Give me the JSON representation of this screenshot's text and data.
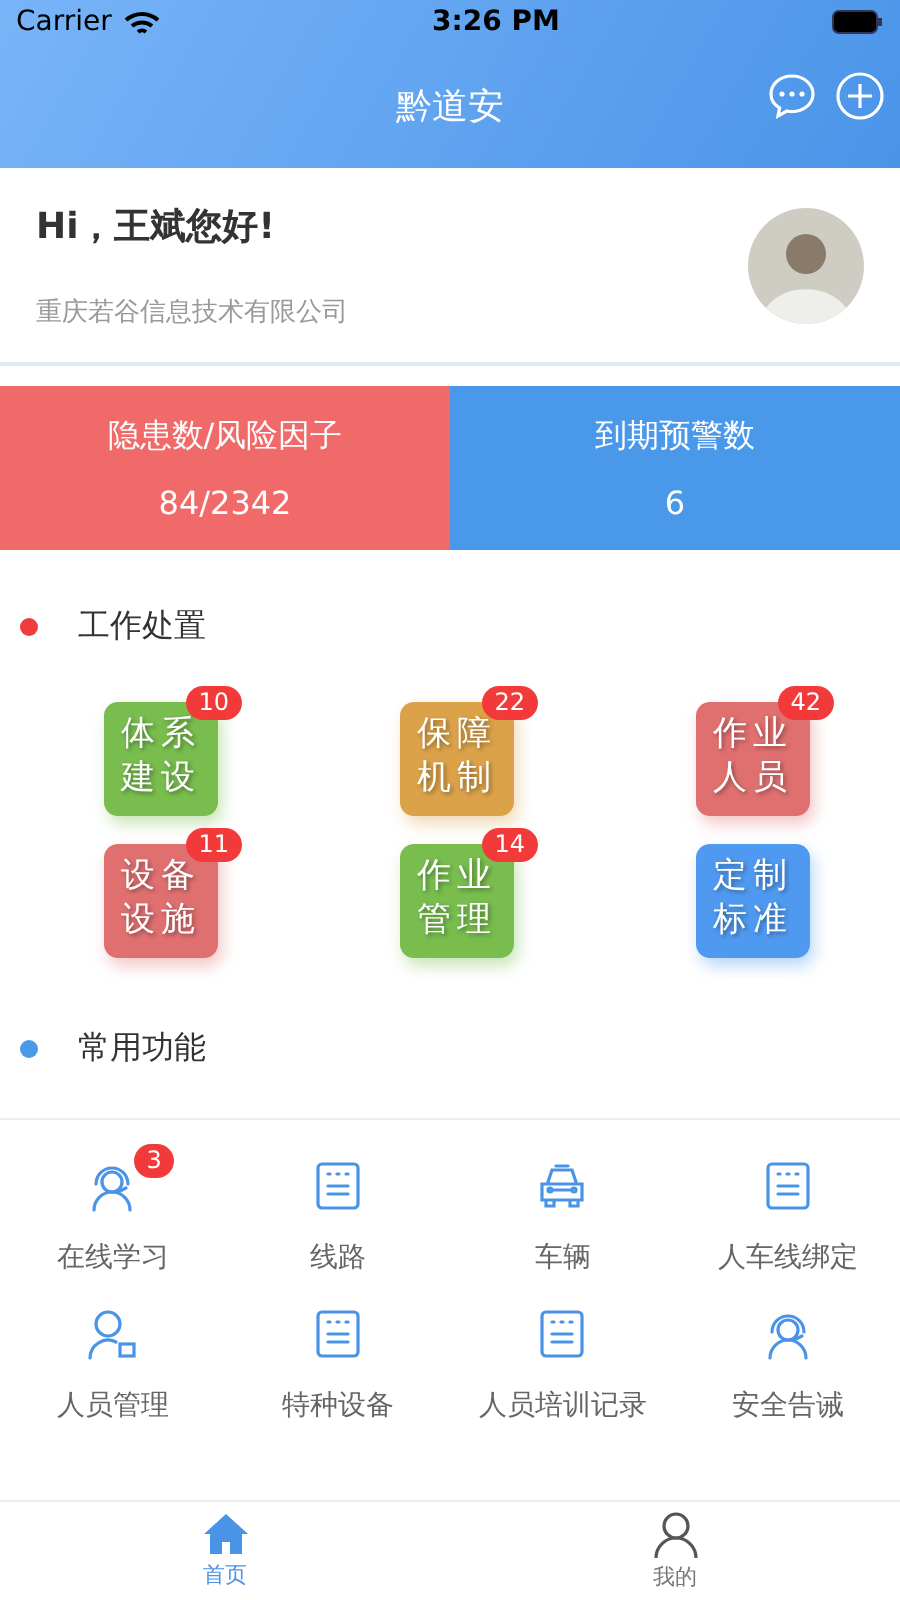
{
  "status_bar": {
    "carrier": "Carrier",
    "time": "3:26 PM"
  },
  "nav": {
    "title": "黔道安"
  },
  "greeting": {
    "title": "Hi，王斌您好!",
    "company": "重庆若谷信息技术有限公司"
  },
  "stats": [
    {
      "label": "隐患数/风险因子",
      "value": "84/2342",
      "color": "#f06a6a"
    },
    {
      "label": "到期预警数",
      "value": "6",
      "color": "#4a98ea"
    }
  ],
  "work_section": {
    "title": "工作处置",
    "color": "#f03c3c",
    "tiles": [
      {
        "label": "体系建设",
        "badge": "10",
        "color": "#78bd4e"
      },
      {
        "label": "保障机制",
        "badge": "22",
        "color": "#dba24a"
      },
      {
        "label": "作业人员",
        "badge": "42",
        "color": "#e07070"
      },
      {
        "label": "设备设施",
        "badge": "11",
        "color": "#e07070"
      },
      {
        "label": "作业管理",
        "badge": "14",
        "color": "#78bd4e"
      },
      {
        "label": "定制标准",
        "color": "#4f9af0"
      }
    ]
  },
  "common_section": {
    "title": "常用功能",
    "color": "#4a98ea",
    "items": [
      {
        "label": "在线学习",
        "kind": "headset",
        "badge": "3"
      },
      {
        "label": "线路",
        "kind": "document"
      },
      {
        "label": "车辆",
        "kind": "car"
      },
      {
        "label": "人车线绑定",
        "kind": "document"
      },
      {
        "label": "人员管理",
        "kind": "person"
      },
      {
        "label": "特种设备",
        "kind": "document"
      },
      {
        "label": "人员培训记录",
        "kind": "document"
      },
      {
        "label": "安全告诫",
        "kind": "headset"
      }
    ]
  },
  "tab_bar": [
    {
      "label": "首页",
      "kind": "home",
      "selected": true
    },
    {
      "label": "我的",
      "kind": "user",
      "selected": false
    }
  ]
}
